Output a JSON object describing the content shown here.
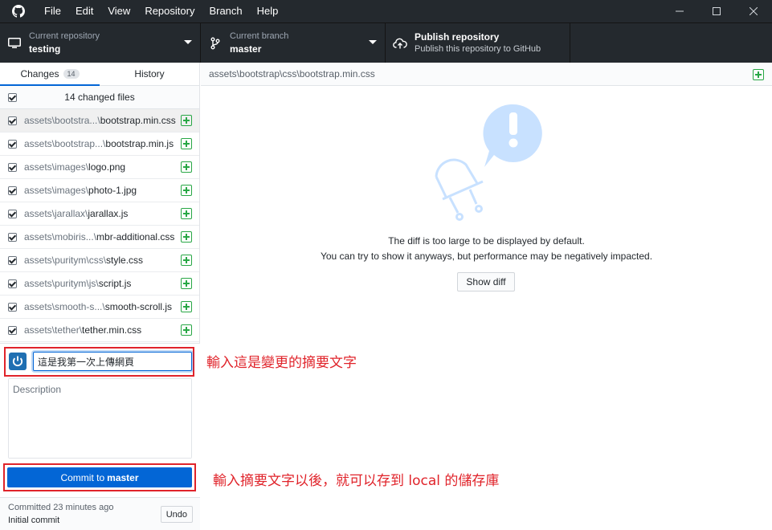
{
  "menu": {
    "items": [
      "File",
      "Edit",
      "View",
      "Repository",
      "Branch",
      "Help"
    ]
  },
  "toolbar": {
    "repo_label": "Current repository",
    "repo_value": "testing",
    "branch_label": "Current branch",
    "branch_value": "master",
    "publish_title": "Publish repository",
    "publish_sub": "Publish this repository to GitHub"
  },
  "tabs": {
    "changes_label": "Changes",
    "changes_count": "14",
    "history_label": "History"
  },
  "changes": {
    "header": "14 changed files",
    "files": [
      {
        "dir": "assets\\bootstra...\\",
        "name": "bootstrap.min.css",
        "checked": true,
        "selected": true
      },
      {
        "dir": "assets\\bootstrap...\\",
        "name": "bootstrap.min.js",
        "checked": true
      },
      {
        "dir": "assets\\images\\",
        "name": "logo.png",
        "checked": true
      },
      {
        "dir": "assets\\images\\",
        "name": "photo-1.jpg",
        "checked": true
      },
      {
        "dir": "assets\\jarallax\\",
        "name": "jarallax.js",
        "checked": true
      },
      {
        "dir": "assets\\mobiris...\\",
        "name": "mbr-additional.css",
        "checked": true
      },
      {
        "dir": "assets\\puritym\\css\\",
        "name": "style.css",
        "checked": true
      },
      {
        "dir": "assets\\puritym\\js\\",
        "name": "script.js",
        "checked": true
      },
      {
        "dir": "assets\\smooth-s...\\",
        "name": "smooth-scroll.js",
        "checked": true
      },
      {
        "dir": "assets\\tether\\",
        "name": "tether.min.css",
        "checked": true
      }
    ]
  },
  "commit": {
    "summary_value": "這是我第一次上傳網頁",
    "description_placeholder": "Description",
    "button_prefix": "Commit to",
    "button_branch": "master"
  },
  "last_commit": {
    "time": "Committed 23 minutes ago",
    "message": "Initial commit",
    "undo_label": "Undo"
  },
  "diff": {
    "path": "assets\\bootstrap\\css\\bootstrap.min.css",
    "message_line1": "The diff is too large to be displayed by default.",
    "message_line2": "You can try to show it anyways, but performance may be negatively impacted.",
    "show_diff_label": "Show diff"
  },
  "annotations": {
    "summary_note": "輸入這是變更的摘要文字",
    "commit_note": "輸入摘要文字以後，就可以存到 local 的儲存庫"
  },
  "colors": {
    "titlebar": "#24292e",
    "accent": "#0366d6",
    "add_green": "#28a745",
    "annotation_red": "#e0232a"
  }
}
